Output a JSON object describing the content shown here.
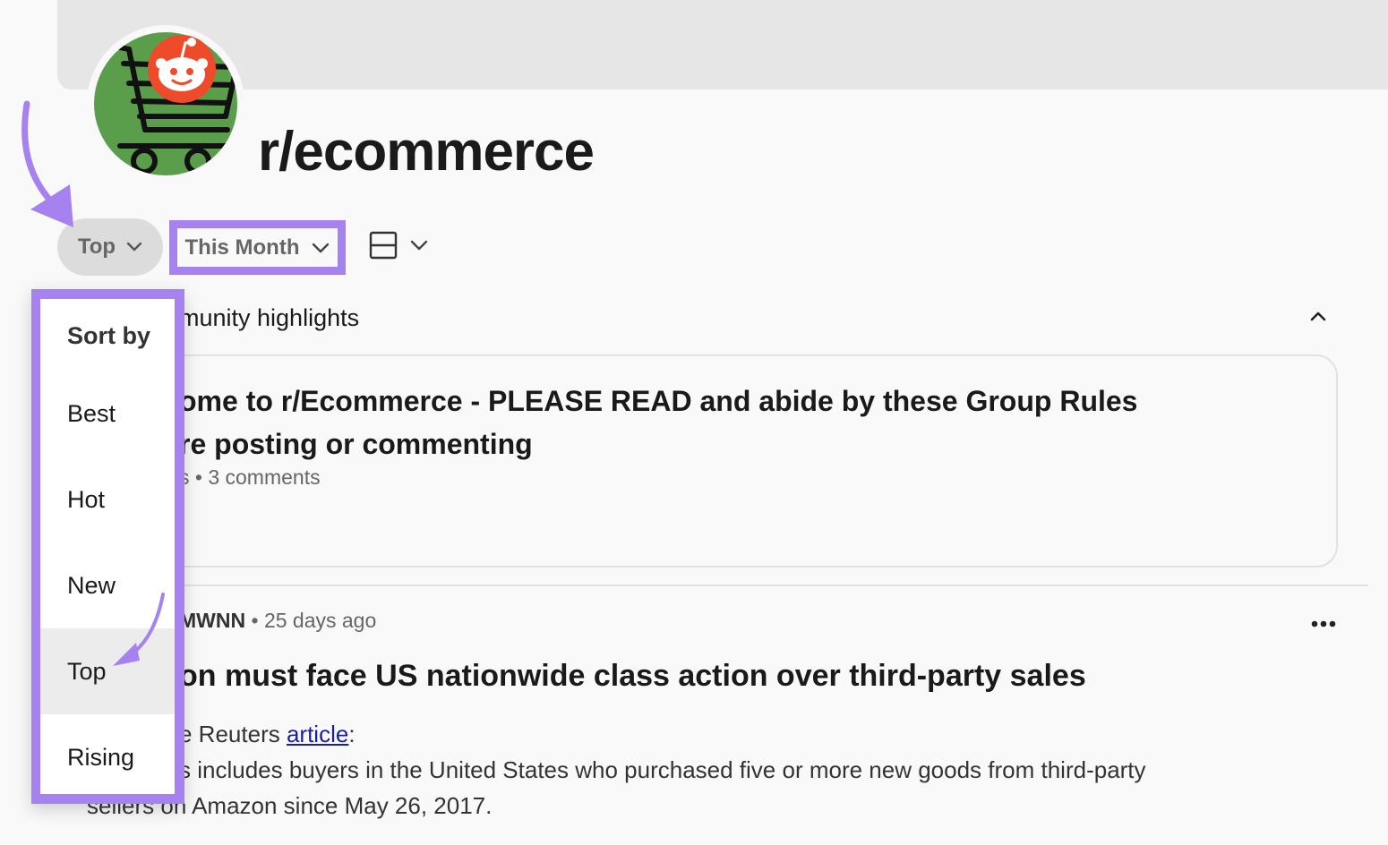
{
  "subreddit": {
    "name": "r/ecommerce"
  },
  "controls": {
    "sort_label": "Top",
    "time_label": "This Month"
  },
  "highlights": {
    "label": "munity highlights",
    "pinned_title": "ome to r/Ecommerce - PLEASE READ and abide by these Group Rules\nre posting or commenting",
    "meta": "s • 3 comments"
  },
  "post": {
    "author": "MWNN",
    "age": "25 days ago",
    "title": "on must face US nationwide class action over third-party sales",
    "body_prefix": "e Reuters ",
    "body_link": "article",
    "body_colon": ":",
    "body_line2": "s includes buyers in the United States who purchased five or more new goods from third-party",
    "body_line3": "sellers on Amazon since May 26, 2017."
  },
  "sort_menu": {
    "header": "Sort by",
    "items": [
      "Best",
      "Hot",
      "New",
      "Top",
      "Rising"
    ],
    "selected": "Top"
  },
  "colors": {
    "highlight": "#a682f0",
    "avatar_bg": "#5a9e4b",
    "reddit_orange": "#ee4b2b"
  }
}
